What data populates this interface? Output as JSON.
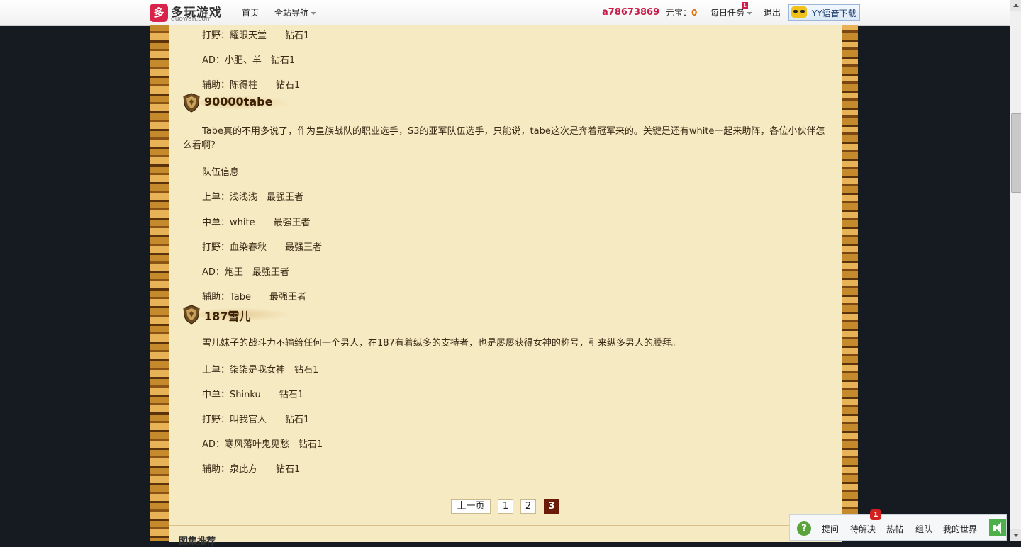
{
  "topbar": {
    "logo_mark": "多",
    "logo_cn": "多玩游戏",
    "logo_en": "duowan.com",
    "nav_home": "首页",
    "nav_all": "全站导航",
    "username": "a78673869",
    "yuanbao_label": "元宝：",
    "yuanbao_value": "0",
    "daily_task": "每日任务",
    "daily_task_badge": "1",
    "logout": "退出",
    "yy_download": "YY语音下载"
  },
  "content": {
    "top_lines": [
      "打野：耀眼天堂　　钻石1",
      "AD：小肥、羊　钻石1",
      "辅助：陈得柱　　钻石1"
    ],
    "sections": [
      {
        "title": "90000tabe",
        "description": "Tabe真的不用多说了，作为皇族战队的职业选手，S3的亚军队伍选手，只能说，tabe这次是奔着冠军来的。关键是还有white一起来助阵，各位小伙伴怎么看啊?",
        "team_info": "队伍信息",
        "lines": [
          "上单：浅浅浅　最强王者",
          "中单：white　　最强王者",
          "打野：血染春秋　　最强王者",
          "AD：炮王　最强王者",
          "辅助：Tabe　　最强王者"
        ]
      },
      {
        "title": "187雪儿",
        "description": "雪儿妹子的战斗力不输给任何一个男人，在187有着纵多的支持者，也是屡屡获得女神的称号，引来纵多男人的膜拜。",
        "lines": [
          "上单：柒柒是我女神　钻石1",
          "中单：Shinku　　钻石1",
          "打野：叫我官人　　钻石1",
          "AD：寒风落叶鬼见愁　钻石1",
          "辅助：泉此方　　钻石1"
        ]
      }
    ],
    "bottom_section_title": "图集推荐"
  },
  "pagination": {
    "prev": "上一页",
    "pages": [
      "1",
      "2",
      "3"
    ],
    "current": "3"
  },
  "toolbar": {
    "help_icon": "?",
    "items": [
      "提问",
      "待解决",
      "热帖",
      "组队",
      "我的世界"
    ],
    "badge": "1"
  }
}
